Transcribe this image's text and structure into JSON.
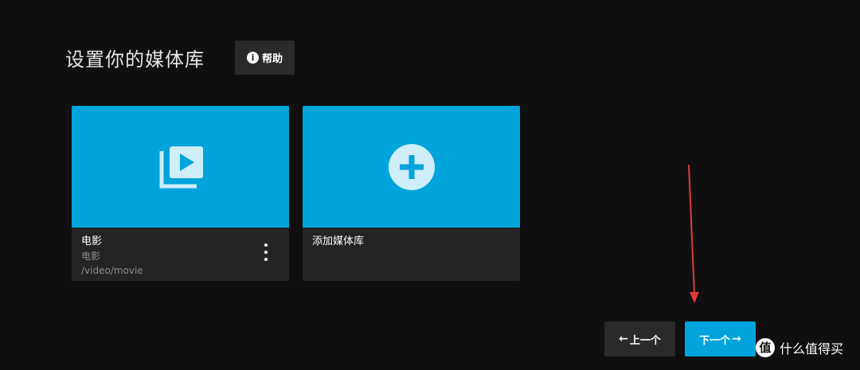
{
  "header": {
    "title": "设置你的媒体库",
    "help_label": "帮助",
    "help_icon": "info-icon"
  },
  "libraries": [
    {
      "name": "电影",
      "type": "电影",
      "path": "/video/movie",
      "icon": "video-library-icon"
    },
    {
      "name": "添加媒体库",
      "icon": "add-circle-icon"
    }
  ],
  "navigation": {
    "prev_label": "上一个",
    "next_label": "下一个",
    "prev_arrow": "←",
    "next_arrow": "→"
  },
  "watermark": {
    "logo_char": "值",
    "text": "什么值得买"
  },
  "colors": {
    "accent": "#00a4dc",
    "background": "#0f0f0f",
    "card": "#242424",
    "annotation": "#e23a3a"
  }
}
